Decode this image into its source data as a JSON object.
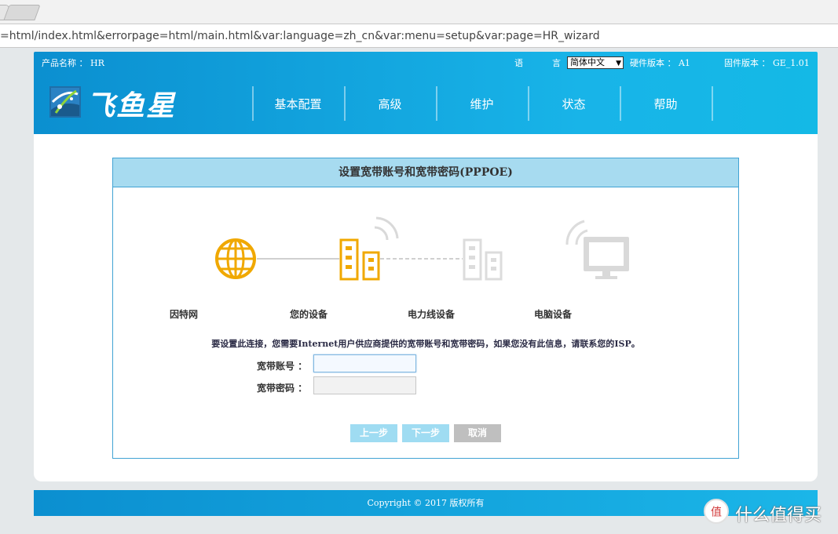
{
  "browser": {
    "url": "=html/index.html&errorpage=html/main.html&var:language=zh_cn&var:menu=setup&var:page=HR_wizard"
  },
  "header": {
    "product_name": "产品名称 ： HR",
    "language_label_1": "语",
    "language_label_2": "言",
    "language_value": "简体中文",
    "hardware_version": "硬件版本 ： A1",
    "firmware_version": "固件版本 ： GE_1.01",
    "logo_text": "飞鱼星",
    "nav": [
      "基本配置",
      "高级",
      "维护",
      "状态",
      "帮助"
    ]
  },
  "wizard": {
    "title": "设置宽带账号和宽带密码(PPPOE)",
    "steps": [
      "因特网",
      "您的设备",
      "电力线设备",
      "电脑设备"
    ],
    "info": "要设置此连接，您需要Internet用户供应商提供的宽带账号和宽带密码，如果您没有此信息，请联系您的ISP。",
    "account_label": "宽带账号 ：",
    "password_label": "宽带密码 ：",
    "account_value": "",
    "password_value": "",
    "prev_label": "上一步",
    "next_label": "下一步",
    "cancel_label": "取消"
  },
  "footer": {
    "copyright": "Copyright © 2017 版权所有"
  },
  "watermark": {
    "text": "什么值得买",
    "icon": "值"
  },
  "colors": {
    "header_blue": "#18b4e8",
    "active_step": "#f0a800",
    "inactive_step": "#d6d6d6",
    "title_bar": "#a7dbf0"
  }
}
